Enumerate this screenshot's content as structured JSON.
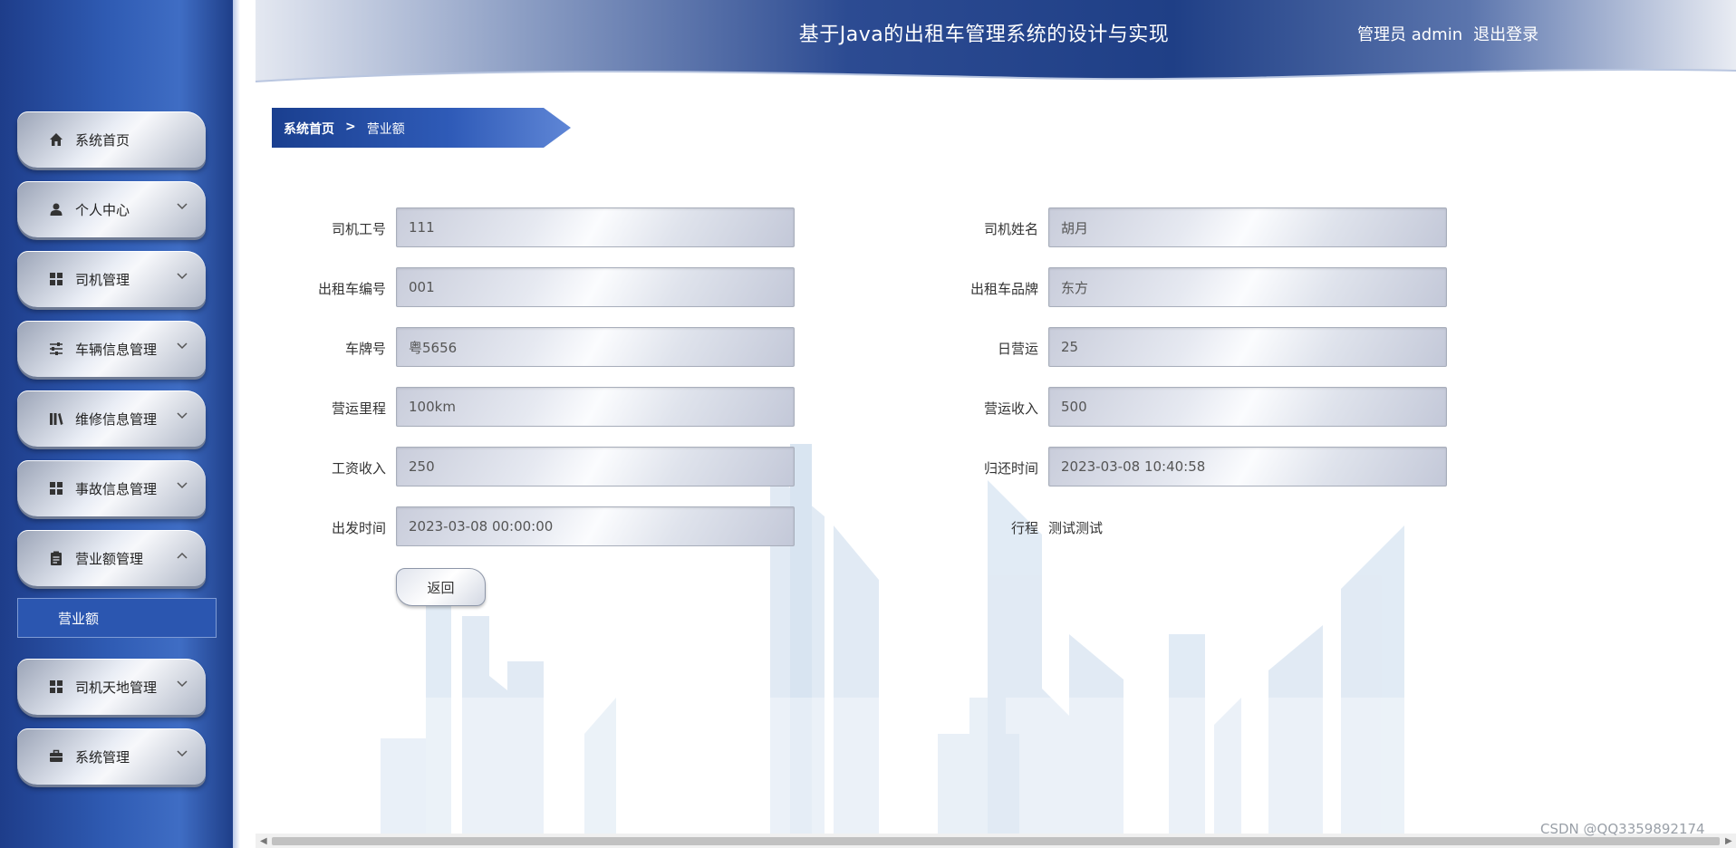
{
  "header": {
    "title": "基于Java的出租车管理系统的设计与实现",
    "user_label": "管理员 admin",
    "logout_label": "退出登录"
  },
  "sidebar": {
    "items": [
      {
        "label": "系统首页",
        "icon": "home-icon",
        "expandable": false
      },
      {
        "label": "个人中心",
        "icon": "user-icon",
        "expandable": true
      },
      {
        "label": "司机管理",
        "icon": "grid-icon",
        "expandable": true
      },
      {
        "label": "车辆信息管理",
        "icon": "sliders-icon",
        "expandable": true
      },
      {
        "label": "维修信息管理",
        "icon": "library-icon",
        "expandable": true
      },
      {
        "label": "事故信息管理",
        "icon": "grid-icon",
        "expandable": true
      },
      {
        "label": "营业额管理",
        "icon": "clipboard-icon",
        "expandable": true,
        "expanded": true
      },
      {
        "label": "司机天地管理",
        "icon": "grid-icon",
        "expandable": true
      },
      {
        "label": "系统管理",
        "icon": "briefcase-icon",
        "expandable": true
      }
    ],
    "submenu": {
      "label": "营业额"
    }
  },
  "breadcrumb": {
    "home": "系统首页",
    "separator": ">",
    "current": "营业额"
  },
  "form": {
    "driver_id": {
      "label": "司机工号",
      "value": "111"
    },
    "driver_name": {
      "label": "司机姓名",
      "value": "胡月"
    },
    "taxi_number": {
      "label": "出租车编号",
      "value": "001"
    },
    "taxi_brand": {
      "label": "出租车品牌",
      "value": "东方"
    },
    "plate_number": {
      "label": "车牌号",
      "value": "粤5656"
    },
    "daily_operation": {
      "label": "日营运",
      "value": "25"
    },
    "mileage": {
      "label": "营运里程",
      "value": "100km"
    },
    "revenue": {
      "label": "营运收入",
      "value": "500"
    },
    "salary": {
      "label": "工资收入",
      "value": "250"
    },
    "return_time": {
      "label": "归还时间",
      "value": "2023-03-08 10:40:58"
    },
    "departure_time": {
      "label": "出发时间",
      "value": "2023-03-08 00:00:00"
    },
    "trip": {
      "label": "行程",
      "value": "测试测试"
    },
    "back_label": "返回"
  },
  "watermark": "CSDN @QQ3359892174",
  "colors": {
    "sidebar_dark": "#1e3d8a",
    "sidebar_mid": "#3f6dc4",
    "breadcrumb": "#2a4fa3",
    "header_dark": "#1f3f86"
  }
}
